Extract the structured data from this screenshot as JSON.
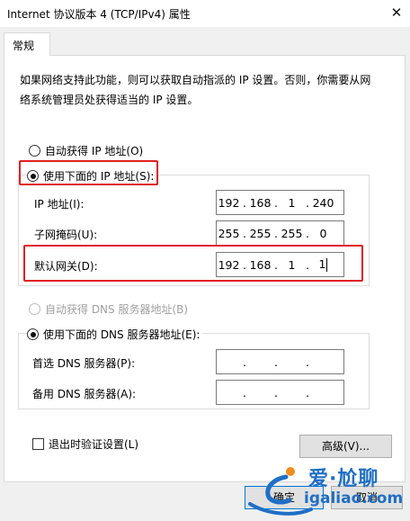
{
  "window": {
    "title": "Internet 协议版本 4 (TCP/IPv4) 属性",
    "close_glyph": "✕"
  },
  "tabs": [
    {
      "label": "常规"
    }
  ],
  "description": "如果网络支持此功能，则可以获取自动指派的 IP 设置。否则，你需要从网络系统管理员处获得适当的 IP 设置。",
  "ip_options": {
    "auto": {
      "label": "自动获得 IP 地址(O)",
      "selected": false
    },
    "manual": {
      "label": "使用下面的 IP 地址(S):",
      "selected": true
    }
  },
  "ip_fields": {
    "ip_address": {
      "label": "IP 地址(I):",
      "octets": [
        "192",
        "168",
        "1",
        "240"
      ]
    },
    "subnet_mask": {
      "label": "子网掩码(U):",
      "octets": [
        "255",
        "255",
        "255",
        "0"
      ]
    },
    "default_gateway": {
      "label": "默认网关(D):",
      "octets": [
        "192",
        "168",
        "1",
        "1"
      ]
    }
  },
  "dns_options": {
    "auto": {
      "label": "自动获得 DNS 服务器地址(B)",
      "selected": false,
      "disabled": true
    },
    "manual": {
      "label": "使用下面的 DNS 服务器地址(E):",
      "selected": true
    }
  },
  "dns_fields": {
    "preferred": {
      "label": "首选 DNS 服务器(P):",
      "octets": [
        "",
        "",
        "",
        ""
      ]
    },
    "alternate": {
      "label": "备用 DNS 服务器(A):",
      "octets": [
        "",
        "",
        "",
        ""
      ]
    }
  },
  "validate_on_exit": {
    "label": "退出时验证设置(L)",
    "checked": false
  },
  "buttons": {
    "advanced": "高级(V)...",
    "ok": "确定",
    "cancel": "取消"
  },
  "watermark": {
    "brand": "爱·尬聊",
    "url": "igaliao.com"
  },
  "colors": {
    "highlight_red": "#e02020",
    "dialog_bg": "#f0f0f0",
    "watermark_blue": "#1f6fc5"
  }
}
